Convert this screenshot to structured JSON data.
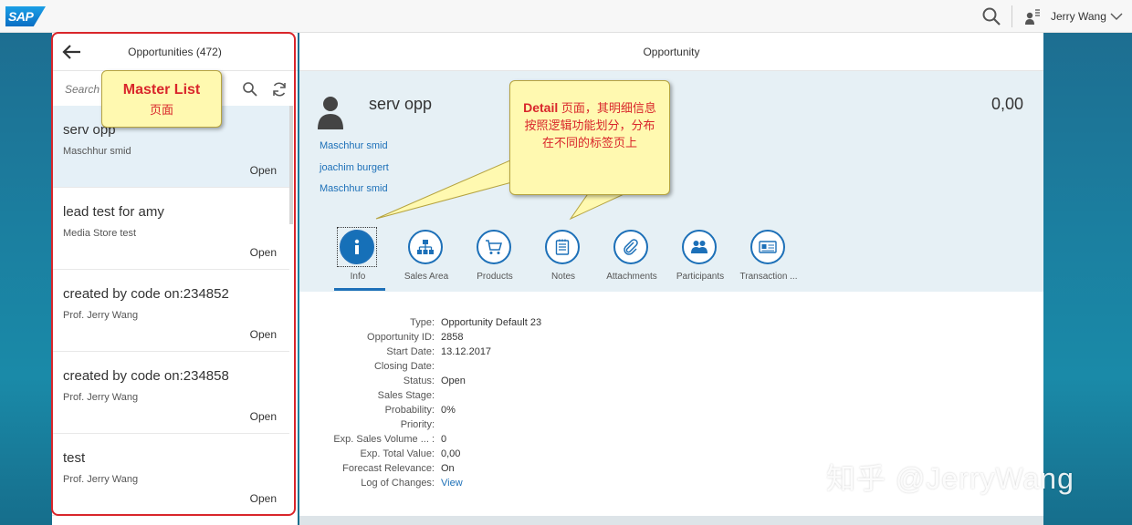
{
  "shell": {
    "logo_text": "SAP",
    "user_name": "Jerry Wang"
  },
  "master": {
    "title": "Opportunities (472)",
    "search_placeholder": "Search",
    "items": [
      {
        "title": "serv opp",
        "subtitle": "Maschhur smid",
        "status": "Open",
        "selected": true
      },
      {
        "title": "lead test for amy",
        "subtitle": "Media Store test",
        "status": "Open",
        "selected": false
      },
      {
        "title": "created by code on:234852",
        "subtitle": "Prof. Jerry Wang",
        "status": "Open",
        "selected": false
      },
      {
        "title": "created by code on:234858",
        "subtitle": "Prof. Jerry Wang",
        "status": "Open",
        "selected": false
      },
      {
        "title": "test",
        "subtitle": "Prof. Jerry Wang",
        "status": "Open",
        "selected": false
      }
    ]
  },
  "detail": {
    "title": "Opportunity",
    "object_title": "serv opp",
    "object_number": "0,00",
    "attributes": [
      "Maschhur smid",
      "joachim burgert",
      "Maschhur smid"
    ],
    "tabs": [
      {
        "label": "Info",
        "icon": "info-icon",
        "active": true
      },
      {
        "label": "Sales Area",
        "icon": "hierarchy-icon",
        "active": false
      },
      {
        "label": "Products",
        "icon": "cart-icon",
        "active": false
      },
      {
        "label": "Notes",
        "icon": "notes-icon",
        "active": false
      },
      {
        "label": "Attachments",
        "icon": "paperclip-icon",
        "active": false
      },
      {
        "label": "Participants",
        "icon": "group-icon",
        "active": false
      },
      {
        "label": "Transaction ...",
        "icon": "id-card-icon",
        "active": false
      }
    ],
    "fields": [
      {
        "label": "Type:",
        "value": "Opportunity Default 23"
      },
      {
        "label": "Opportunity ID:",
        "value": "2858"
      },
      {
        "label": "Start Date:",
        "value": "13.12.2017"
      },
      {
        "label": "Closing Date:",
        "value": ""
      },
      {
        "label": "Status:",
        "value": "Open"
      },
      {
        "label": "Sales Stage:",
        "value": ""
      },
      {
        "label": "Probability:",
        "value": "0%"
      },
      {
        "label": "Priority:",
        "value": ""
      },
      {
        "label": "Exp. Sales Volume ... :",
        "value": "0"
      },
      {
        "label": "Exp. Total Value:",
        "value": "0,00"
      },
      {
        "label": "Forecast Relevance:",
        "value": "On"
      },
      {
        "label": "Log of Changes:",
        "value": "View",
        "link": true
      }
    ]
  },
  "callouts": {
    "master_line1": "Master List",
    "master_line2": "页面",
    "detail_bold": "Detail",
    "detail_rest": " 页面，其明细信息按照逻辑功能划分，分布在不同的标签页上"
  },
  "watermark": "知乎 @JerryWang",
  "colors": {
    "accent": "#1d70b8",
    "annotation_red": "#d9262b",
    "callout_bg": "#fff9b0",
    "header_bg": "#e6f0f5"
  }
}
